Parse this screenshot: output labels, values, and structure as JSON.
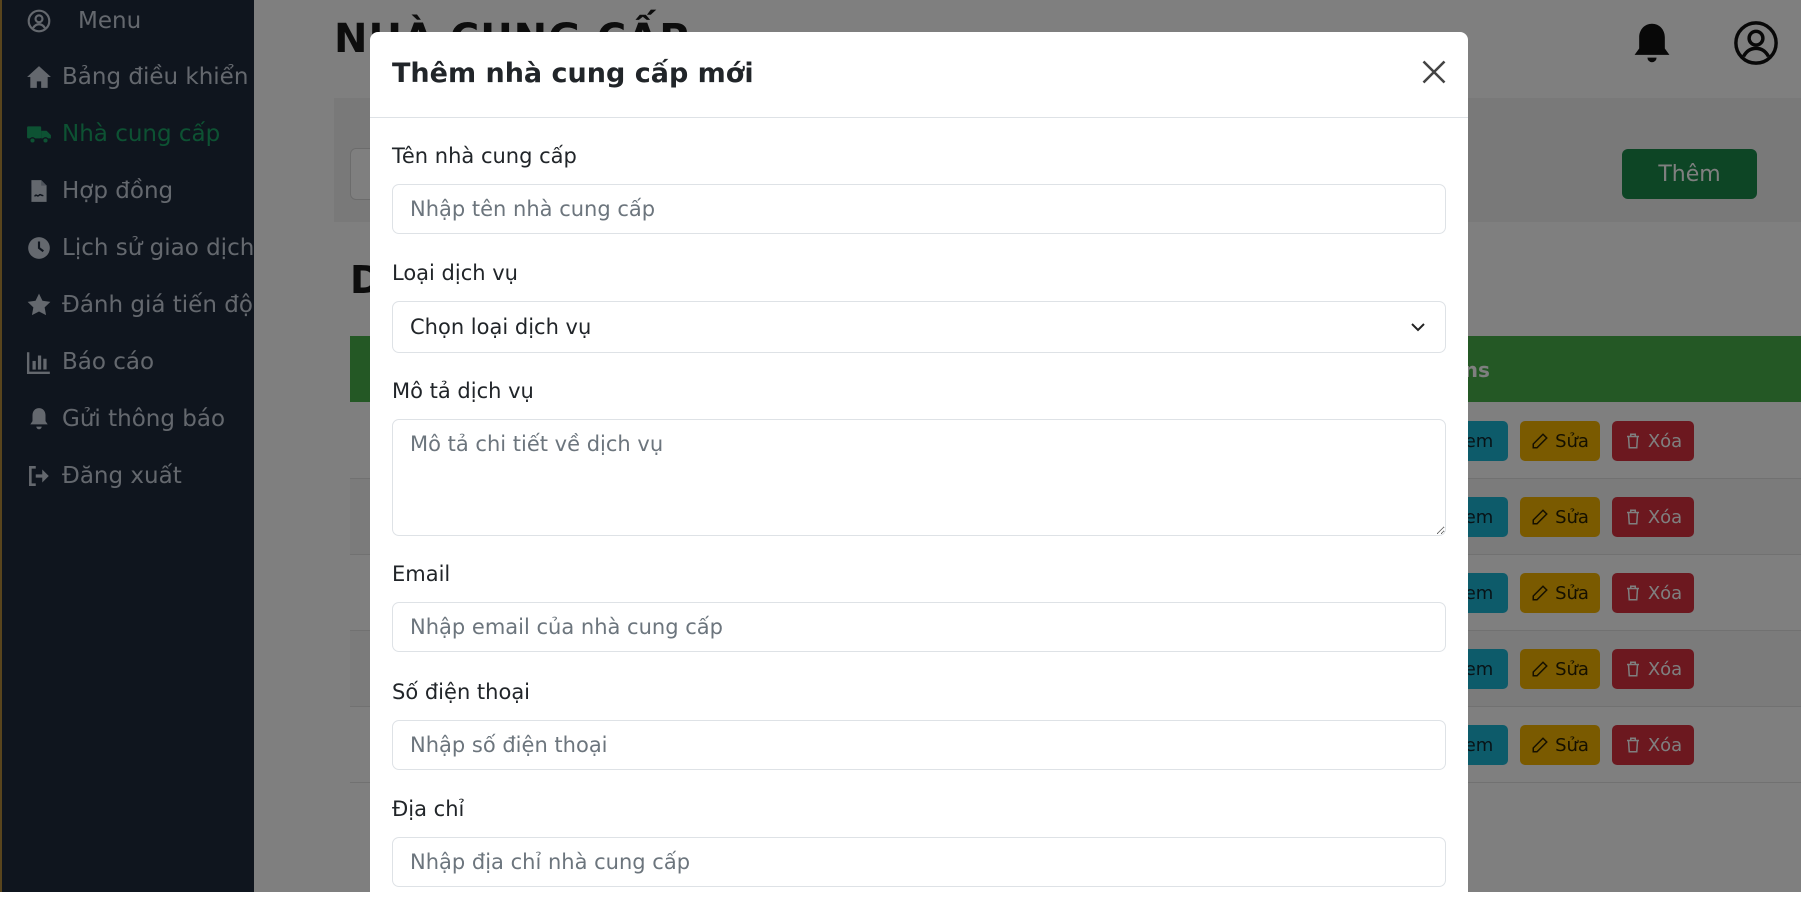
{
  "sidebar": {
    "items": [
      {
        "label": "Menu",
        "icon": "user-circle-icon"
      },
      {
        "label": "Bảng điều khiển",
        "icon": "home-icon"
      },
      {
        "label": "Nhà cung cấp",
        "icon": "truck-icon",
        "active": true
      },
      {
        "label": "Hợp đồng",
        "icon": "contract-icon"
      },
      {
        "label": "Lịch sử giao dịch",
        "icon": "clock-icon"
      },
      {
        "label": "Đánh giá tiến độ",
        "icon": "star-icon"
      },
      {
        "label": "Báo cáo",
        "icon": "chart-icon"
      },
      {
        "label": "Gửi thông báo",
        "icon": "bell-icon"
      },
      {
        "label": "Đăng xuất",
        "icon": "logout-icon"
      }
    ]
  },
  "header": {
    "title": "NHÀ CUNG CẤP"
  },
  "filters": {
    "add_label": "Thêm"
  },
  "list": {
    "title": "D",
    "actions_header": "ons",
    "view_label": "em",
    "edit_label": "Sửa",
    "delete_label": "Xóa"
  },
  "modal": {
    "title": "Thêm nhà cung cấp mới",
    "fields": {
      "name": {
        "label": "Tên nhà cung cấp",
        "placeholder": "Nhập tên nhà cung cấp"
      },
      "service_type": {
        "label": "Loại dịch vụ",
        "value": "Chọn loại dịch vụ"
      },
      "description": {
        "label": "Mô tả dịch vụ",
        "placeholder": "Mô tả chi tiết về dịch vụ"
      },
      "email": {
        "label": "Email",
        "placeholder": "Nhập email của nhà cung cấp"
      },
      "phone": {
        "label": "Số điện thoại",
        "placeholder": "Nhập số điện thoại"
      },
      "address": {
        "label": "Địa chỉ",
        "placeholder": "Nhập địa chỉ nhà cung cấp"
      }
    }
  },
  "colors": {
    "sidebar_bg": "#1f2a3c",
    "accent_green": "#1aa566",
    "table_header": "#48b04b",
    "add_button": "#1b8a4b",
    "view_button": "#1bb6d4",
    "edit_button": "#f4b400",
    "delete_button": "#d9303f"
  }
}
